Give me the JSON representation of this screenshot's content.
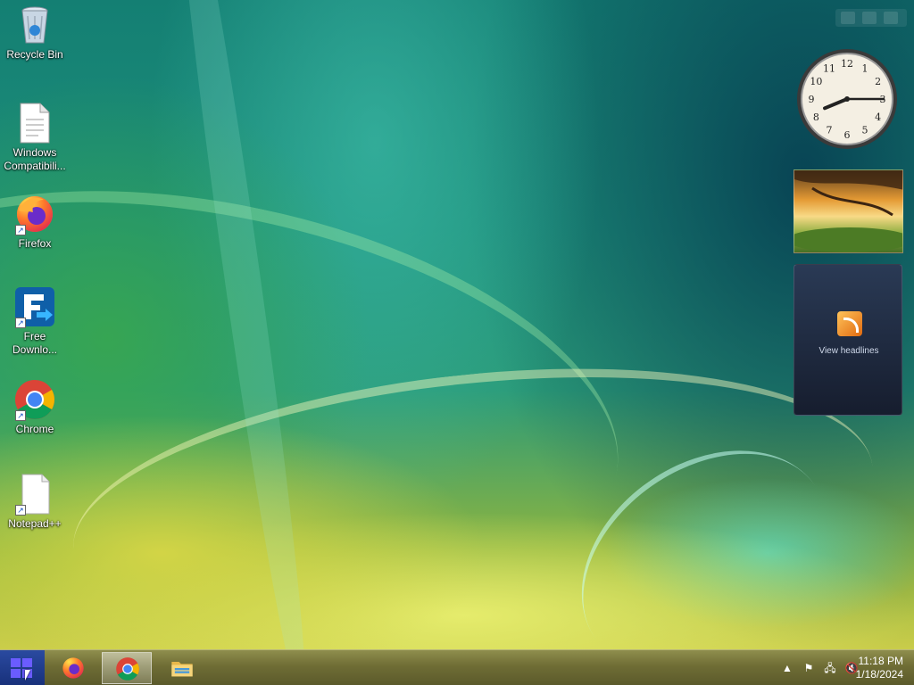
{
  "desktop": {
    "icons": [
      {
        "label": "Recycle Bin",
        "icon": "recycle-bin-icon"
      },
      {
        "label": "Windows Compatibili...",
        "icon": "document-icon"
      },
      {
        "label": "Firefox",
        "icon": "firefox-icon"
      },
      {
        "label": "Free Downlo...",
        "icon": "free-download-manager-icon"
      },
      {
        "label": "Chrome",
        "icon": "chrome-icon"
      },
      {
        "label": "Notepad++",
        "icon": "notepad-plus-plus-icon"
      }
    ]
  },
  "gadgets": {
    "clock": {
      "hour": 8,
      "minute": 15
    },
    "feed": {
      "label": "View headlines"
    }
  },
  "taskbar": {
    "start_icon": "windows-logo-icon",
    "pinned": [
      {
        "name": "Firefox",
        "icon": "firefox-icon",
        "active": false
      },
      {
        "name": "Chrome",
        "icon": "chrome-icon",
        "active": true
      },
      {
        "name": "File Explorer",
        "icon": "folder-icon",
        "active": false
      }
    ],
    "tray": {
      "icons": [
        "chevron-up-icon",
        "flag-icon",
        "network-icon",
        "speaker-muted-icon"
      ],
      "time": "11:18 PM",
      "date": "1/18/2024"
    }
  }
}
